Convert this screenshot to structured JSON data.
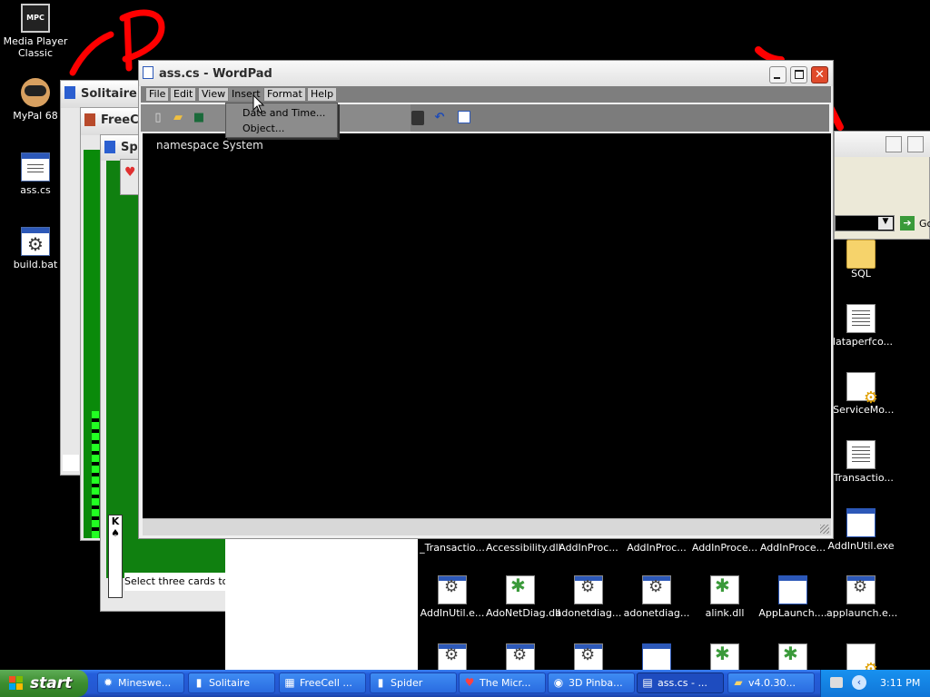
{
  "desktop": {
    "left_icons": [
      {
        "label": "Media Player Classic",
        "icon": "clapperboard-icon",
        "badge": "MPC"
      },
      {
        "label": "MyPal 68",
        "icon": "raccoon-icon"
      },
      {
        "label": "ass.cs",
        "icon": "cs-file-icon"
      },
      {
        "label": "build.bat",
        "icon": "batch-file-icon"
      }
    ]
  },
  "background_windows": {
    "solitaire_title": "Solitaire",
    "freecell_title": "FreeC",
    "spider_title": "Sp",
    "spider_status": "Select three cards to p",
    "spider_card": "K",
    "explorer_go": "Go"
  },
  "explorer_files": {
    "right_column": [
      {
        "label": "SQL",
        "icon": "folder-icon"
      },
      {
        "label": "dataperfco...",
        "icon": "text-file-icon"
      },
      {
        "label": "_ServiceMo...",
        "icon": "config-file-icon"
      },
      {
        "label": "_Transactio...",
        "icon": "text-file-icon"
      },
      {
        "label": "AddInUtil.exe",
        "icon": "exe-file-icon"
      }
    ],
    "row1": [
      {
        "label": "_Transactio...",
        "icon": "config-file-icon"
      },
      {
        "label": "Accessibility.dll",
        "icon": "dll-file-icon"
      },
      {
        "label": "AddInProc...",
        "icon": "exe-file-icon"
      },
      {
        "label": "AddInProc...",
        "icon": "config-file-icon"
      },
      {
        "label": "AddInProce...",
        "icon": "exe-file-icon"
      },
      {
        "label": "AddInProce...",
        "icon": "config-file-icon"
      }
    ],
    "row2": [
      {
        "label": "AddInUtil.e...",
        "icon": "dll-exe-icon"
      },
      {
        "label": "AdoNetDiag.dll",
        "icon": "dll-file-icon"
      },
      {
        "label": "adonetdiag...",
        "icon": "dll-exe-icon"
      },
      {
        "label": "adonetdiag...",
        "icon": "dll-exe-icon"
      },
      {
        "label": "alink.dll",
        "icon": "dll-file-icon"
      },
      {
        "label": "AppLaunch....",
        "icon": "exe-file-icon"
      },
      {
        "label": "applaunch.e...",
        "icon": "dll-exe-icon"
      }
    ],
    "row3_icons": [
      "dll-exe-icon",
      "dll-exe-icon",
      "dll-exe-icon",
      "exe-file-icon",
      "dll-file-icon",
      "dll-file-icon",
      "config-file-icon"
    ]
  },
  "wordpad": {
    "title": "ass.cs - WordPad",
    "menu": [
      "File",
      "Edit",
      "View",
      "Insert",
      "Format",
      "Help"
    ],
    "insert_menu": [
      "Date and Time...",
      "Object..."
    ],
    "content": [
      "namespace System"
    ],
    "toolbar_icons": [
      "new-document-icon",
      "open-folder-icon",
      "save-icon",
      "insert-object-icon",
      "undo-icon",
      "date-time-icon"
    ]
  },
  "taskbar": {
    "start_label": "start",
    "tasks": [
      {
        "label": "Mineswe...",
        "icon": "minesweeper-icon"
      },
      {
        "label": "Solitaire",
        "icon": "solitaire-icon"
      },
      {
        "label": "FreeCell ...",
        "icon": "freecell-icon"
      },
      {
        "label": "Spider",
        "icon": "spider-icon"
      },
      {
        "label": "The Micr...",
        "icon": "hearts-icon"
      },
      {
        "label": "3D Pinba...",
        "icon": "pinball-icon"
      },
      {
        "label": "ass.cs - ...",
        "icon": "wordpad-icon",
        "active": true
      },
      {
        "label": "v4.0.30...",
        "icon": "folder-icon"
      }
    ],
    "clock": "3:11 PM"
  },
  "colors": {
    "desktop": "#000000",
    "taskbar_blue": "#245edb",
    "start_green": "#3c8d2f",
    "felt_green": "#108010",
    "annotation_red": "#ff0000"
  }
}
